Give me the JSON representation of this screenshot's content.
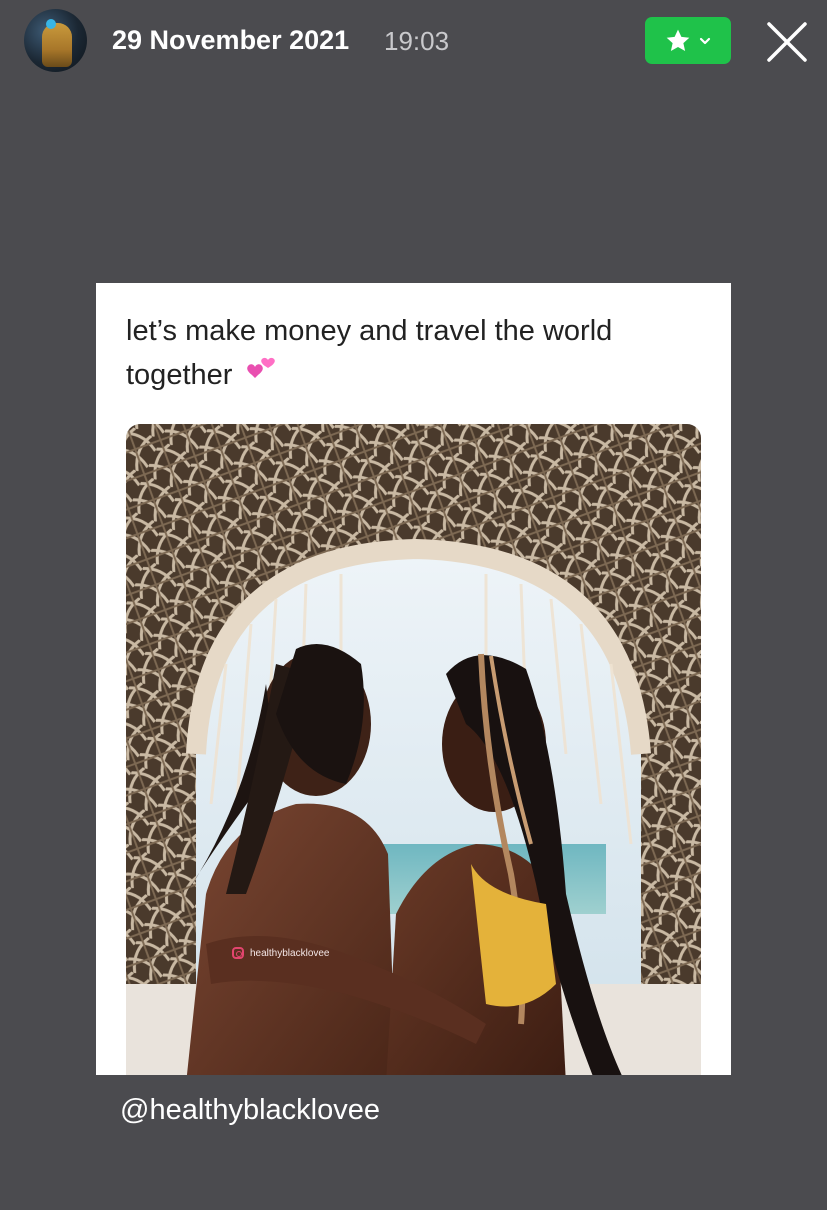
{
  "header": {
    "avatar_icon": "user-avatar-icon",
    "date": "29 November 2021",
    "time": "19:03",
    "star_button": {
      "icon": "star-icon",
      "dropdown_icon": "chevron-down-icon",
      "color": "#1fc24a"
    },
    "close_icon": "close-icon"
  },
  "post": {
    "text": "let’s make money and travel the world together",
    "emoji": "two-hearts-emoji",
    "image": {
      "watermark": "healthyblacklovee"
    },
    "caption": "@healthyblacklovee"
  },
  "colors": {
    "background": "#4b4b4f",
    "accent": "#1fc24a"
  }
}
